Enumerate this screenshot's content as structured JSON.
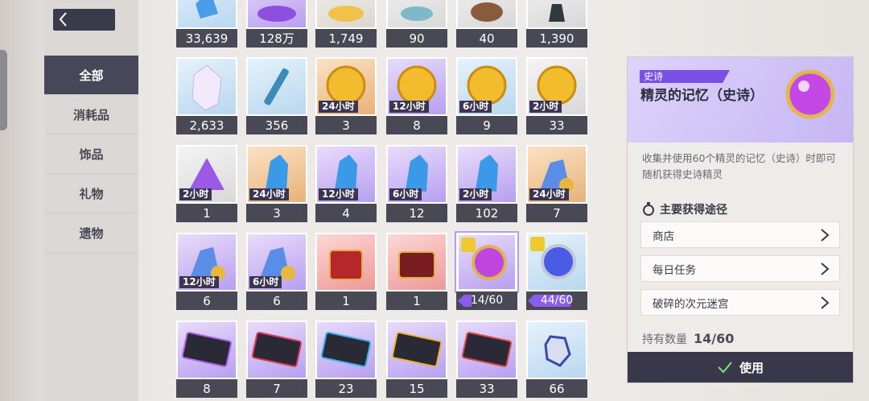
{
  "sidebar": {
    "categories": [
      {
        "label": "全部",
        "active": true
      },
      {
        "label": "消耗品"
      },
      {
        "label": "饰品"
      },
      {
        "label": "礼物"
      },
      {
        "label": "遗物"
      }
    ]
  },
  "grid": {
    "row1": [
      "33,639",
      "128万",
      "1,749",
      "90",
      "40",
      "1,390"
    ],
    "row2": [
      {
        "count": "2,633"
      },
      {
        "count": "356"
      },
      {
        "count": "3",
        "timer": "24小时"
      },
      {
        "count": "8",
        "timer": "12小时"
      },
      {
        "count": "9",
        "timer": "6小时"
      },
      {
        "count": "33",
        "timer": "2小时"
      }
    ],
    "row3": [
      {
        "count": "1",
        "timer": "2小时"
      },
      {
        "count": "3",
        "timer": "24小时"
      },
      {
        "count": "4",
        "timer": "12小时"
      },
      {
        "count": "12",
        "timer": "6小时"
      },
      {
        "count": "102",
        "timer": "2小时"
      },
      {
        "count": "7",
        "timer": "24小时"
      }
    ],
    "row4": [
      {
        "count": "6",
        "timer": "12小时"
      },
      {
        "count": "6",
        "timer": "6小时"
      },
      {
        "count": "1"
      },
      {
        "count": "1"
      },
      {
        "progress": "14/60",
        "fraction": 0.233
      },
      {
        "progress": "44/60",
        "fraction": 0.733
      }
    ],
    "row5": [
      "8",
      "7",
      "23",
      "15",
      "33",
      "66"
    ]
  },
  "detail": {
    "rarity": "史诗",
    "name": "精灵的记忆（史诗）",
    "description": "收集并使用60个精灵的记忆（史诗）时即可随机获得史诗精灵",
    "sources_title": "主要获得途径",
    "sources": [
      "商店",
      "每日任务",
      "破碎的次元迷宫"
    ],
    "owned_label": "持有数量",
    "owned_value": "14/60",
    "use_label": "使用"
  },
  "colors": {
    "accent": "#7a4fe4",
    "dark": "#494956"
  }
}
